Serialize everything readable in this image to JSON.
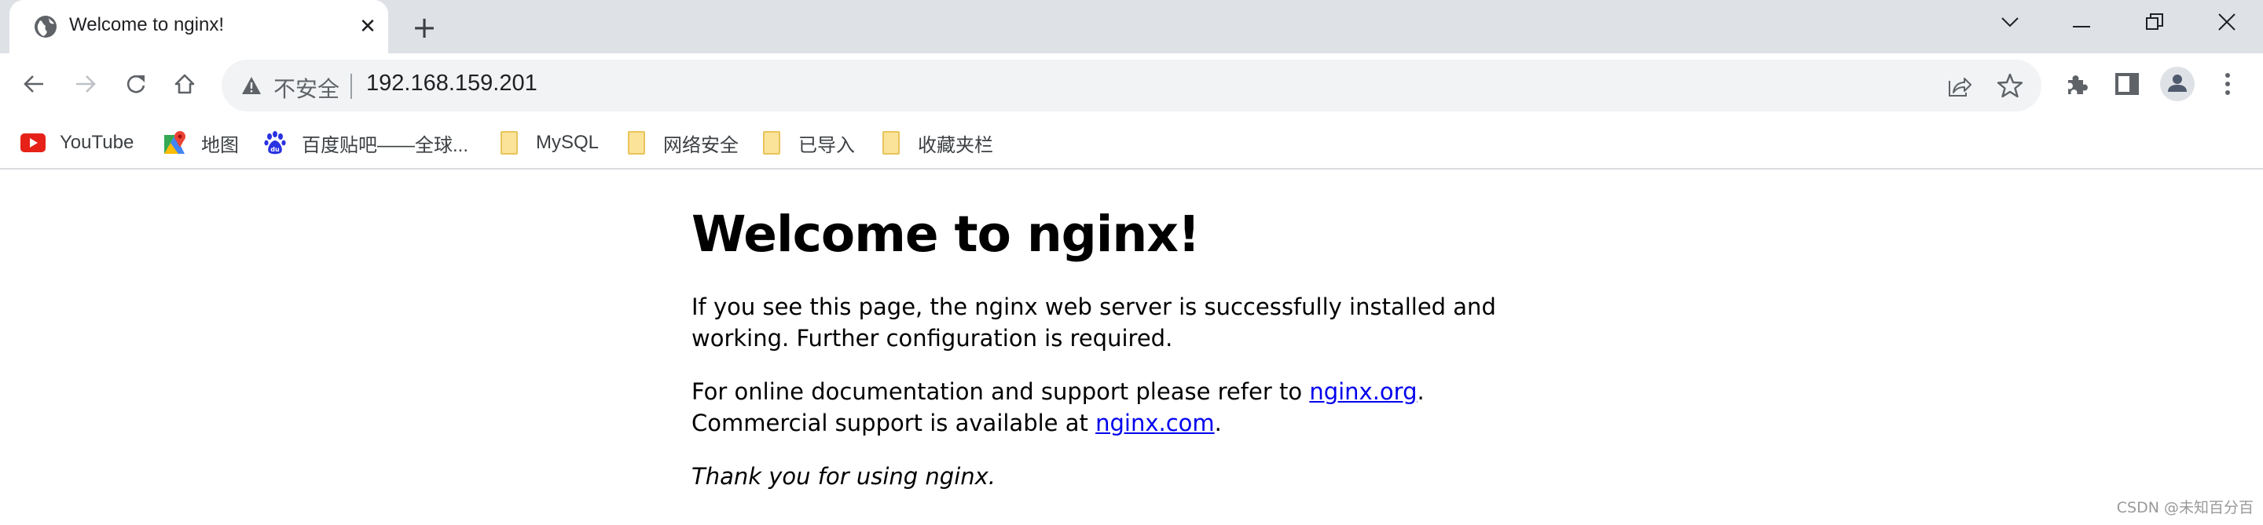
{
  "browser": {
    "tab": {
      "title": "Welcome to nginx!",
      "favicon": "globe-icon"
    },
    "new_tab_label": "+",
    "window_controls": [
      "tab-search",
      "minimize",
      "restore",
      "close"
    ],
    "omnibox": {
      "security_label": "不安全",
      "url": "192.168.159.201"
    },
    "bookmarks": [
      {
        "label": "YouTube",
        "icon": "youtube-icon"
      },
      {
        "label": "地图",
        "icon": "maps-icon"
      },
      {
        "label": "百度贴吧——全球...",
        "icon": "baidu-icon"
      },
      {
        "label": "MySQL",
        "icon": "folder-icon"
      },
      {
        "label": "网络安全",
        "icon": "folder-icon"
      },
      {
        "label": "已导入",
        "icon": "folder-icon"
      },
      {
        "label": "收藏夹栏",
        "icon": "folder-icon"
      }
    ]
  },
  "page": {
    "heading": "Welcome to nginx!",
    "para1": "If you see this page, the nginx web server is successfully installed and working. Further configuration is required.",
    "para2_prefix": "For online documentation and support please refer to ",
    "link_org": "nginx.org",
    "para2_mid": ".",
    "para2_line2": "Commercial support is available at ",
    "link_com": "nginx.com",
    "para2_end": ".",
    "thanks": "Thank you for using nginx."
  },
  "watermark": "CSDN @未知百分百"
}
